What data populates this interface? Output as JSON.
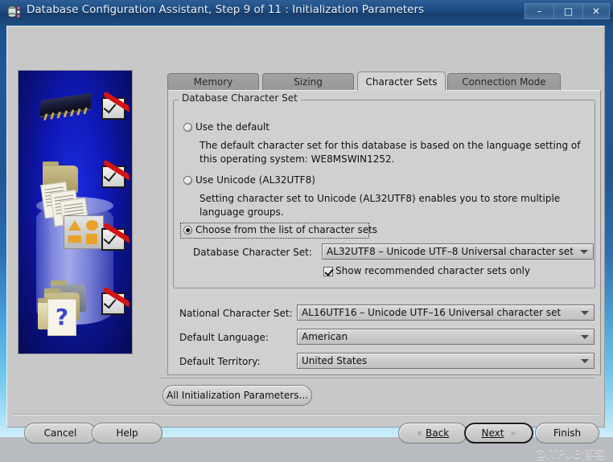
{
  "window": {
    "title": "Database Configuration Assistant, Step 9 of 11 : Initialization Parameters",
    "icon": "database-icon",
    "controls": {
      "minimize": "–",
      "maximize": "□",
      "close": "✕"
    }
  },
  "tabs": [
    {
      "label": "Memory",
      "active": false
    },
    {
      "label": "Sizing",
      "active": false
    },
    {
      "label": "Character Sets",
      "active": true
    },
    {
      "label": "Connection Mode",
      "active": false
    }
  ],
  "group": {
    "legend": "Database Character Set",
    "options": [
      {
        "label": "Use the default",
        "selected": false,
        "description": "The default character set for this database is based on the language setting of this operating system: WE8MSWIN1252."
      },
      {
        "label": "Use Unicode (AL32UTF8)",
        "selected": false,
        "description": "Setting character set to Unicode (AL32UTF8) enables you to store multiple language groups."
      },
      {
        "label": "Choose from the list of character sets",
        "selected": true,
        "focused": true,
        "description": ""
      }
    ],
    "db_charset_label": "Database Character Set:",
    "db_charset_value": "AL32UTF8 – Unicode UTF–8 Universal character set",
    "show_recommended_label": "Show recommended character sets only",
    "show_recommended_checked": true
  },
  "fields": [
    {
      "label": "National Character Set:",
      "value": "AL16UTF16 – Unicode UTF–16 Universal character set"
    },
    {
      "label": "Default Language:",
      "value": "American"
    },
    {
      "label": "Default Territory:",
      "value": "United States"
    }
  ],
  "buttons": {
    "all_params": "All Initialization Parameters...",
    "cancel": "Cancel",
    "help": "Help",
    "back": "Back",
    "back_accel": "B",
    "next": "Next",
    "next_accel": "N",
    "finish": "Finish",
    "finish_accel": "F",
    "back_arrow": "«",
    "next_arrow": "»"
  },
  "watermark": "@ITPUB博客",
  "colors": {
    "title_bar": "#1d4d86",
    "frame": "#2a6fb5",
    "client_bg": "#c8c8c8",
    "panel_bg": "#d0d0d0",
    "tab_inactive": "#989898",
    "tab_active": "#d4d4d4",
    "art_bg": "#1018b8",
    "check_red": "#d41414"
  }
}
